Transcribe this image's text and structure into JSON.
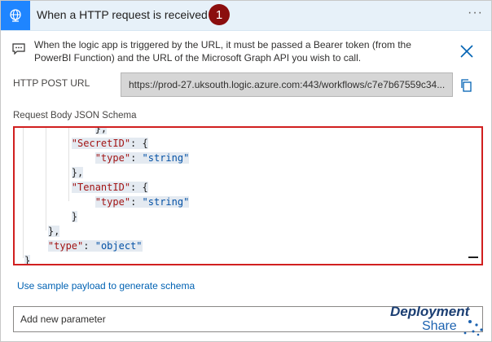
{
  "header": {
    "title": "When a HTTP request is received",
    "badge": "1",
    "more": "···"
  },
  "info": {
    "text": "When the logic app is triggered by the URL, it must be passed a Bearer token (from the PowerBI Function) and the URL of the Microsoft Graph API you wish to call."
  },
  "post": {
    "label": "HTTP POST URL",
    "url": "https://prod-27.uksouth.logic.azure.com:443/workflows/c7e7b67559c34..."
  },
  "schema": {
    "label": "Request Body JSON Schema",
    "lines": [
      {
        "indent": "            ",
        "key": "",
        "rest": "},"
      },
      {
        "indent": "        ",
        "key": "\"SecretID\"",
        "rest": ": {"
      },
      {
        "indent": "            ",
        "key": "\"type\"",
        "rest": ": ",
        "value": "\"string\""
      },
      {
        "indent": "        ",
        "key": "",
        "rest": "},"
      },
      {
        "indent": "        ",
        "key": "\"TenantID\"",
        "rest": ": {"
      },
      {
        "indent": "            ",
        "key": "\"type\"",
        "rest": ": ",
        "value": "\"string\""
      },
      {
        "indent": "        ",
        "key": "",
        "rest": "}"
      },
      {
        "indent": "    ",
        "key": "",
        "rest": "},"
      },
      {
        "indent": "    ",
        "key": "\"type\"",
        "rest": ": ",
        "value": "\"object\""
      },
      {
        "indent": "",
        "key": "",
        "rest": "}"
      }
    ]
  },
  "sample_link": "Use sample payload to generate schema",
  "add_param": "Add new parameter",
  "logo": {
    "line1": "Deployment",
    "line2": "Share"
  },
  "colors": {
    "header_bg": "#e7f1f9",
    "icon_bg": "#1f85ff",
    "badge": "#8b0e0e",
    "highlight_border": "#d11f1f",
    "link": "#0062b3"
  }
}
